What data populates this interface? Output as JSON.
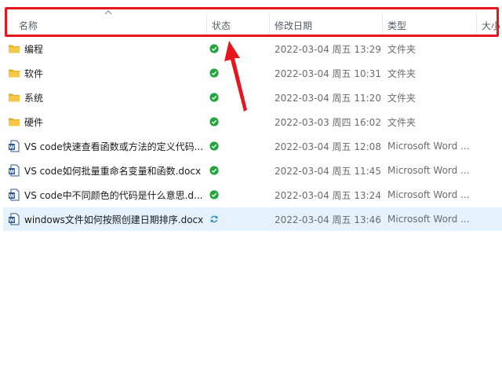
{
  "header": {
    "columns": {
      "name": "名称",
      "status": "状态",
      "modified": "修改日期",
      "type": "类型",
      "size": "大小"
    },
    "sort_indicator": "caret-up-icon",
    "highlight_color": "#e8141e"
  },
  "rows": [
    {
      "name": "编程",
      "status": "synced",
      "modified": "2022-03-04 周五 13:29",
      "type": "文件夹",
      "icon": "folder-icon"
    },
    {
      "name": "软件",
      "status": "synced",
      "modified": "2022-03-04 周五 10:31",
      "type": "文件夹",
      "icon": "folder-icon"
    },
    {
      "name": "系统",
      "status": "synced",
      "modified": "2022-03-04 周五 11:20",
      "type": "文件夹",
      "icon": "folder-icon"
    },
    {
      "name": "硬件",
      "status": "synced",
      "modified": "2022-03-03 周四 16:02",
      "type": "文件夹",
      "icon": "folder-icon"
    },
    {
      "name": "VS code快速查看函数或方法的定义代码...",
      "status": "synced",
      "modified": "2022-03-04 周五 12:08",
      "type": "Microsoft Word ...",
      "icon": "word-doc-icon"
    },
    {
      "name": "VS code如何批量重命名变量和函数.docx",
      "status": "synced",
      "modified": "2022-03-04 周五 11:45",
      "type": "Microsoft Word ...",
      "icon": "word-doc-icon"
    },
    {
      "name": "VS code中不同颜色的代码是什么意思.d...",
      "status": "synced",
      "modified": "2022-03-04 周五 13:24",
      "type": "Microsoft Word ...",
      "icon": "word-doc-icon"
    },
    {
      "name": "windows文件如何按照创建日期排序.docx",
      "status": "syncing",
      "modified": "2022-03-04 周五 13:46",
      "type": "Microsoft Word ...",
      "icon": "word-doc-icon",
      "selected": true
    }
  ],
  "colors": {
    "folder": "#f4c23d",
    "word": "#2b579a",
    "synced": "#23a43c",
    "syncing": "#1b8fc4",
    "selection": "#e5f1fb",
    "arrow": "#e8141e"
  }
}
